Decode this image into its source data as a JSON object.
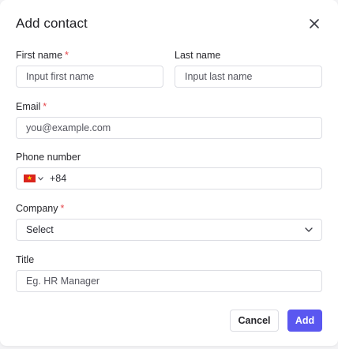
{
  "dialog": {
    "title": "Add contact"
  },
  "fields": {
    "first_name": {
      "label": "First name",
      "required_mark": "*",
      "placeholder": "Input first name"
    },
    "last_name": {
      "label": "Last name",
      "placeholder": "Input last name"
    },
    "email": {
      "label": "Email",
      "required_mark": "*",
      "placeholder": "you@example.com"
    },
    "phone": {
      "label": "Phone number",
      "country_flag": "vietnam-flag-icon",
      "dial_code": "+84"
    },
    "company": {
      "label": "Company",
      "required_mark": "*",
      "selected": "Select"
    },
    "title": {
      "label": "Title",
      "placeholder": "Eg. HR Manager"
    }
  },
  "actions": {
    "cancel_label": "Cancel",
    "add_label": "Add"
  },
  "colors": {
    "accent": "#5a57f0",
    "required": "#e5484d",
    "border": "#dcdde3"
  }
}
